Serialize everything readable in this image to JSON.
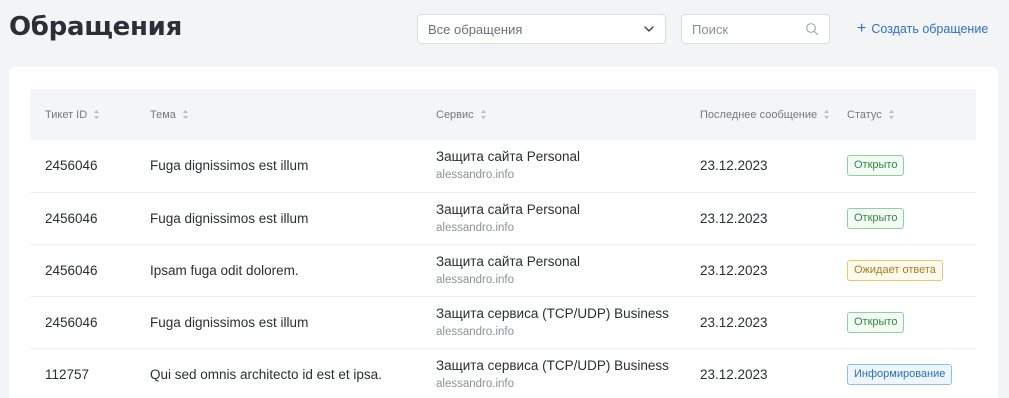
{
  "header": {
    "title": "Обращения",
    "filter_value": "Все обращения",
    "search_placeholder": "Поиск",
    "create_label": "Создать обращение"
  },
  "table": {
    "columns": [
      "Тикет ID",
      "Тема",
      "Сервис",
      "Последнее сообщение",
      "Статус"
    ],
    "rows": [
      {
        "id": "2456046",
        "topic": "Fuga dignissimos est illum",
        "service": "Защита сайта Personal",
        "host": "alessandro.info",
        "date": "23.12.2023",
        "status": "Открыто",
        "status_kind": "open"
      },
      {
        "id": "2456046",
        "topic": "Fuga dignissimos est illum",
        "service": "Защита сайта Personal",
        "host": "alessandro.info",
        "date": "23.12.2023",
        "status": "Открыто",
        "status_kind": "open"
      },
      {
        "id": "2456046",
        "topic": "Ipsam fuga odit dolorem.",
        "service": "Защита сайта Personal",
        "host": "alessandro.info",
        "date": "23.12.2023",
        "status": "Ожидает ответа",
        "status_kind": "waiting"
      },
      {
        "id": "2456046",
        "topic": "Fuga dignissimos est illum",
        "service": "Защита сервиса (TCP/UDP) Business",
        "host": "alessandro.info",
        "date": "23.12.2023",
        "status": "Открыто",
        "status_kind": "open"
      },
      {
        "id": "112757",
        "topic": "Qui sed omnis architecto id est et ipsa.",
        "service": "Защита сервиса (TCP/UDP) Business",
        "host": "alessandro.info",
        "date": "23.12.2023",
        "status": "Информирование",
        "status_kind": "info"
      }
    ]
  },
  "colors": {
    "accent": "#2f6fce",
    "open": {
      "text": "#2e8b3e",
      "border": "#8fd19a",
      "bg": "#f3fbf4"
    },
    "waiting": {
      "text": "#b07a10",
      "border": "#f0c56a",
      "bg": "#fffaf0"
    },
    "info": {
      "text": "#2a6fb8",
      "border": "#8cc0ec",
      "bg": "#eef6fd"
    }
  },
  "icons": {
    "filter": "chevron-down-icon",
    "search": "search-icon",
    "create": "plus-icon",
    "sort": "sort-icon"
  }
}
